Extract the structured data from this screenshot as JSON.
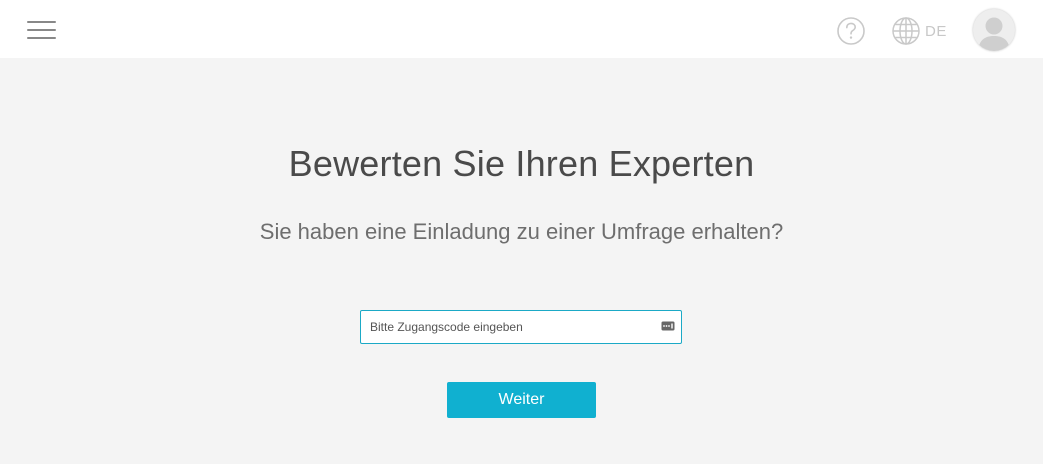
{
  "header": {
    "menu_icon": "hamburger-menu-icon",
    "help_icon": "question-circle-icon",
    "language": {
      "icon": "globe-icon",
      "label": "DE"
    },
    "avatar_icon": "user-avatar-icon"
  },
  "main": {
    "title": "Bewerten Sie Ihren Experten",
    "subtitle": "Sie haben eine Einladung zu einer Umfrage erhalten?",
    "access_code": {
      "value": "",
      "placeholder": "Bitte Zugangscode eingeben",
      "icon": "password-key-icon"
    },
    "submit_label": "Weiter"
  },
  "colors": {
    "accent": "#10b0d0",
    "input_border": "#1ba9c6",
    "header_bg": "#ffffff",
    "page_bg": "#f4f4f4"
  }
}
